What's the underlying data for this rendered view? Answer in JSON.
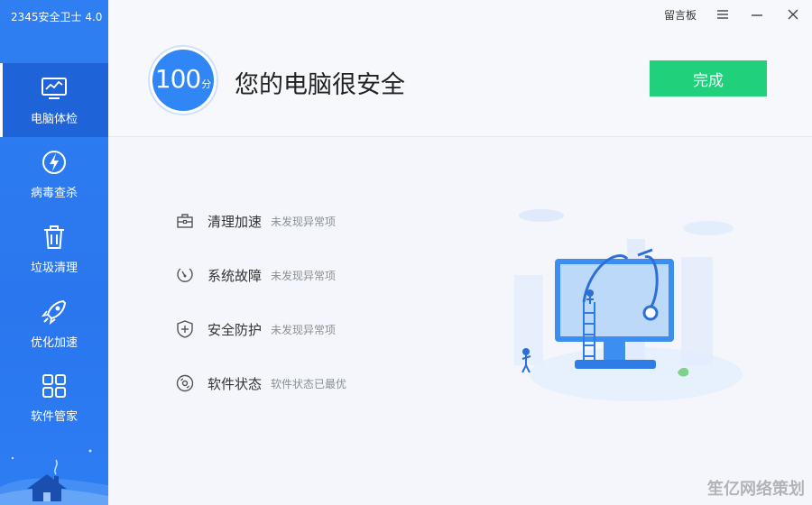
{
  "app": {
    "title": "2345安全卫士 4.0"
  },
  "titlebar": {
    "feedback_label": "留言板",
    "menu_icon": "hamburger-menu-icon",
    "minimize_icon": "minimize-icon",
    "close_icon": "close-icon"
  },
  "sidebar": {
    "items": [
      {
        "label": "电脑体检",
        "icon": "monitor-icon",
        "active": true
      },
      {
        "label": "病毒查杀",
        "icon": "lightning-shield-icon",
        "active": false
      },
      {
        "label": "垃圾清理",
        "icon": "trash-icon",
        "active": false
      },
      {
        "label": "优化加速",
        "icon": "rocket-icon",
        "active": false
      },
      {
        "label": "软件管家",
        "icon": "apps-grid-icon",
        "active": false
      }
    ]
  },
  "header": {
    "score": "100",
    "score_unit": "分",
    "headline": "您的电脑很安全",
    "done_label": "完成"
  },
  "results": [
    {
      "name": "清理加速",
      "status": "未发现异常项",
      "icon": "toolbox-icon"
    },
    {
      "name": "系统故障",
      "status": "未发现异常项",
      "icon": "gauge-icon"
    },
    {
      "name": "安全防护",
      "status": "未发现异常项",
      "icon": "shield-plus-icon"
    },
    {
      "name": "软件状态",
      "status": "软件状态已最优",
      "icon": "disc-icon"
    }
  ],
  "colors": {
    "sidebar": "#2f7ff2",
    "sidebar_active": "#1e63d8",
    "accent_green": "#20d07a",
    "score_blue": "#2f86f4"
  },
  "watermark": "笙亿网络策划"
}
